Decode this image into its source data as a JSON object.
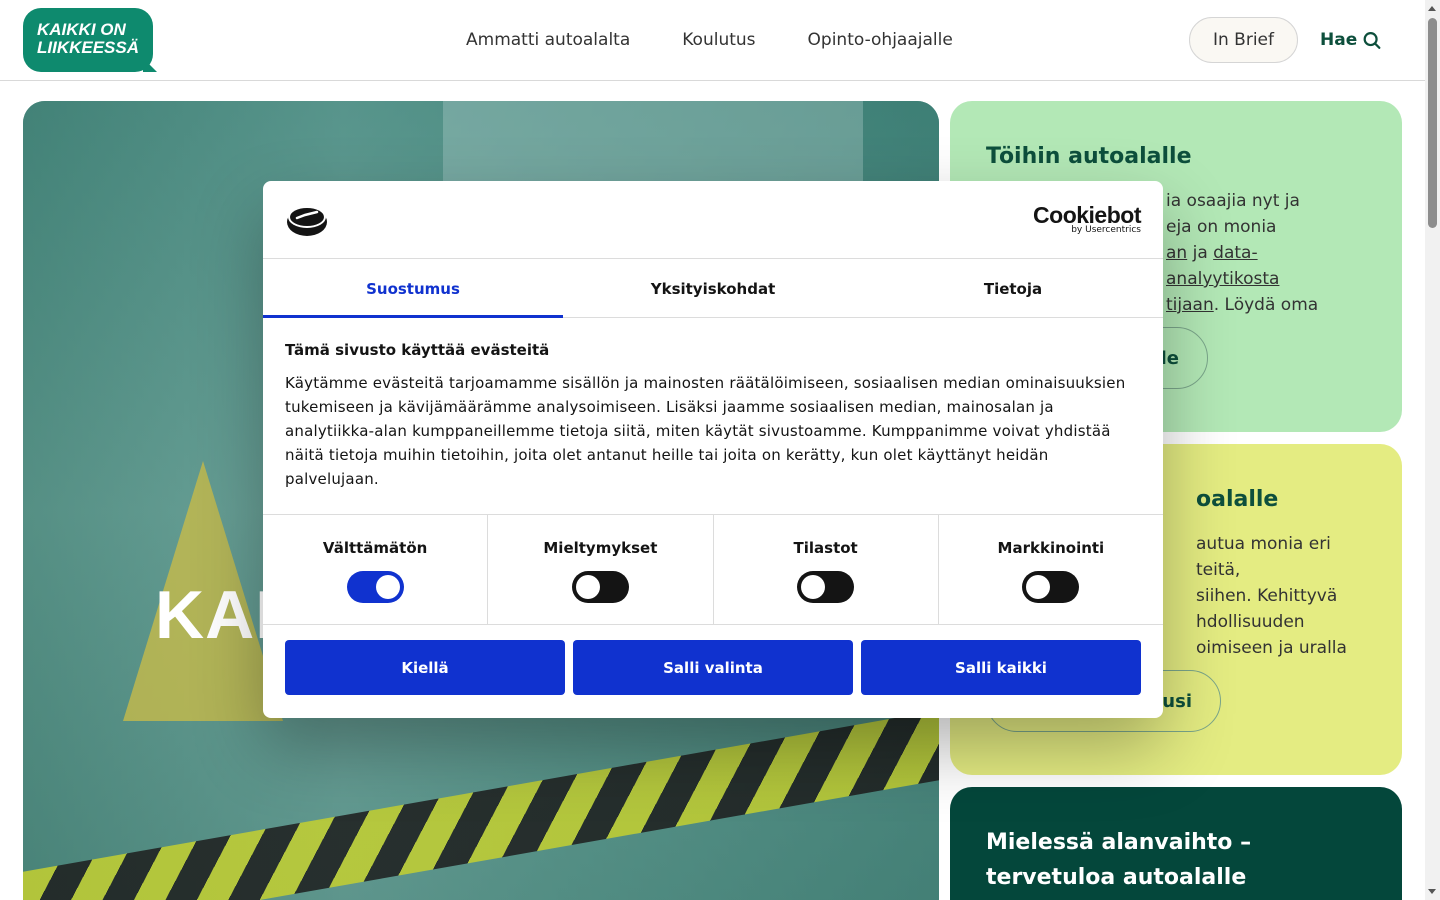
{
  "header": {
    "logo_line1": "KAIKKI ON",
    "logo_line2": "LIIKKEESSÄ",
    "nav": [
      "Ammatti autoalalta",
      "Koulutus",
      "Opinto-ohjaajalle"
    ],
    "in_brief": "In Brief",
    "search_label": "Hae"
  },
  "hero": {
    "title": "KAIKKI"
  },
  "cards": [
    {
      "title": "Töihin autoalalle",
      "text_visible": "ia osaajia nyt ja",
      "line2": "eja on monia",
      "line3_a": "an",
      "line3_mid": " ja ",
      "line3_link": "data-analyytikosta",
      "line4_link": "tijaan",
      "line4_rest": ". Löydä oma",
      "button": "le"
    },
    {
      "title": "oalalle",
      "line1": "autua monia eri teitä,",
      "line2": "siihen. Kehittyvä",
      "line3": "hdollisuuden",
      "line4": "oimiseen ja uralla",
      "button": "usi"
    },
    {
      "title": "Mielessä alanvaihto – tervetuloa autoalalle"
    }
  ],
  "dialog": {
    "brand": "Cookiebot",
    "brand_sub": "by Usercentrics",
    "tabs": [
      "Suostumus",
      "Yksityiskohdat",
      "Tietoja"
    ],
    "heading": "Tämä sivusto käyttää evästeitä",
    "body": "Käytämme evästeitä tarjoamamme sisällön ja mainosten räätälöimiseen, sosiaalisen median ominaisuuksien tukemiseen ja kävijämäärämme analysoimiseen. Lisäksi jaamme sosiaalisen median, mainosalan ja analytiikka-alan kumppaneillemme tietoja siitä, miten käytät sivustoamme. Kumppanimme voivat yhdistää näitä tietoja muihin tietoihin, joita olet antanut heille tai joita on kerätty, kun olet käyttänyt heidän palvelujaan.",
    "toggles": [
      {
        "label": "Välttämätön",
        "on": true
      },
      {
        "label": "Mieltymykset",
        "on": false
      },
      {
        "label": "Tilastot",
        "on": false
      },
      {
        "label": "Markkinointi",
        "on": false
      }
    ],
    "buttons": [
      "Kiellä",
      "Salli valinta",
      "Salli kaikki"
    ]
  },
  "colors": {
    "brand_green": "#0e8a6e",
    "accent_blue": "#1032cf",
    "card1_bg": "#b3e8b6",
    "card2_bg": "#e4ec82",
    "card3_bg": "#04473b"
  }
}
